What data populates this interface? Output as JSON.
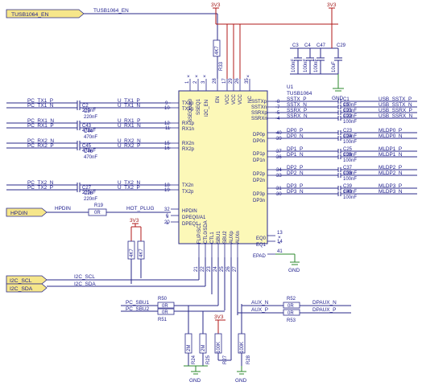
{
  "ic": {
    "designator": "U1",
    "part": "TUSB1064",
    "left_pins": [
      {
        "num": "9",
        "name": "TX1p"
      },
      {
        "num": "10",
        "name": "TX1n"
      },
      {
        "num": "12",
        "name": "RX1p"
      },
      {
        "num": "11",
        "name": "RX1n"
      },
      {
        "num": "15",
        "name": "RX2n"
      },
      {
        "num": "16",
        "name": "RX2p"
      },
      {
        "num": "18",
        "name": "TX2n"
      },
      {
        "num": "19",
        "name": "TX2p"
      },
      {
        "num": "32",
        "name": "HPDIN"
      },
      {
        "num": "6",
        "name": "DPEQ0/A1"
      },
      {
        "num": "20",
        "name": "DPEQ1"
      }
    ],
    "right_pins": [
      {
        "num": "8",
        "name": "SSTXp"
      },
      {
        "num": "7",
        "name": "SSTXn"
      },
      {
        "num": "5",
        "name": "SSRXp"
      },
      {
        "num": "4",
        "name": "SSRXn"
      },
      {
        "num": "40",
        "name": "DP0p"
      },
      {
        "num": "39",
        "name": "DP0n"
      },
      {
        "num": "37",
        "name": "DP1p"
      },
      {
        "num": "36",
        "name": "DP1n"
      },
      {
        "num": "34",
        "name": "DP2p"
      },
      {
        "num": "33",
        "name": "DP2n"
      },
      {
        "num": "31",
        "name": "DP3p"
      },
      {
        "num": "30",
        "name": "DP3n"
      },
      {
        "num": "13",
        "name": "EQ0"
      },
      {
        "num": "14",
        "name": "EQ1"
      },
      {
        "num": "41",
        "name": "EPAD"
      }
    ],
    "top_pins": [
      {
        "num": "1",
        "name": "SSEQ0/A0"
      },
      {
        "num": "2",
        "name": "SSEQ1"
      },
      {
        "num": "3",
        "name": "I2C_EN"
      },
      {
        "num": "28",
        "name": "EN"
      },
      {
        "num": "17",
        "name": "VCC"
      },
      {
        "num": "29",
        "name": "VCC"
      },
      {
        "num": "26",
        "name": "VCC"
      },
      {
        "num": "35",
        "name": "NC"
      }
    ],
    "bottom_pins": [
      {
        "num": "21",
        "name": "FLIP/SCL"
      },
      {
        "num": "22",
        "name": "CTL0/SDA"
      },
      {
        "num": "23",
        "name": "CTL1"
      },
      {
        "num": "24",
        "name": "SBU1"
      },
      {
        "num": "25",
        "name": "SBU2"
      },
      {
        "num": "26",
        "name": "AUXp"
      },
      {
        "num": "27",
        "name": "AUXn"
      }
    ]
  },
  "ports": {
    "tusb_en": "TUSB1064_EN",
    "hpdin": "HPDIN",
    "i2c_scl": "I2C_SCL",
    "i2c_sda": "I2C_SDA"
  },
  "nets": {
    "tusb_en": "TUSB1064_EN",
    "hpdin": "HPDIN",
    "hot_plug": "HOT_PLUG",
    "i2c_scl": "I2C_SCL",
    "i2c_sda": "I2C_SDA",
    "pc_sbu1": "PC_SBU1",
    "pc_sbu2": "PC_SBU2",
    "aux_n": "AUX_N",
    "aux_p": "AUX_P",
    "dpaux_n": "DPAUX_N",
    "dpaux_p": "DPAUX_P"
  },
  "left_channels": [
    {
      "pc": "PC_TX1_P",
      "cap": "C2",
      "val": "220nF",
      "u": "U_TX1_P"
    },
    {
      "pc": "PC_TX1_N",
      "cap": "C3",
      "val": "220nF",
      "u": "U_TX1_N"
    },
    {
      "pc": "PC_RX1_N",
      "cap": "C43",
      "val": "470nF",
      "u": "U_RX1_P"
    },
    {
      "pc": "PC_RX1_P",
      "cap": "C44",
      "val": "470nF",
      "u": "U_RX1_N"
    },
    {
      "pc": "PC_RX2_N",
      "cap": "C45",
      "val": "470nF",
      "u": "U_RX2_N"
    },
    {
      "pc": "PC_RX2_P",
      "cap": "C46",
      "val": "470nF",
      "u": "U_RX2_P"
    },
    {
      "pc": "PC_TX2_N",
      "cap": "C27",
      "val": "220nF",
      "u": "U_TX2_N"
    },
    {
      "pc": "PC_TX2_P",
      "cap": "C28",
      "val": "220nF",
      "u": "U_TX2_P"
    }
  ],
  "right_channels": [
    {
      "net": "SSTX_P",
      "cap": "C1",
      "val": "100nF",
      "out": "USB_SSTX_P"
    },
    {
      "net": "SSTX_N",
      "cap": "C5",
      "val": "100nF",
      "out": "USB_SSTX_N"
    },
    {
      "net": "SSRX_P",
      "cap": "C21",
      "val": "100nF",
      "out": "USB_SSRX_P"
    },
    {
      "net": "SSRX_N",
      "cap": "C22",
      "val": "100nF",
      "out": "USB_SSRX_N"
    },
    {
      "net": "DP0_P",
      "cap": "C23",
      "val": "100nF",
      "out": "MLDP0_P"
    },
    {
      "net": "DP0_N",
      "cap": "C24",
      "val": "100nF",
      "out": "MLDP0_N"
    },
    {
      "net": "DP1_P",
      "cap": "C25",
      "val": "100nF",
      "out": "MLDP1_P"
    },
    {
      "net": "DP1_N",
      "cap": "C26",
      "val": "100nF",
      "out": "MLDP1_N"
    },
    {
      "net": "DP2_P",
      "cap": "C37",
      "val": "100nF",
      "out": "MLDP2_P"
    },
    {
      "net": "DP2_N",
      "cap": "C38",
      "val": "100nF",
      "out": "MLDP2_N"
    },
    {
      "net": "DP3_P",
      "cap": "C39",
      "val": "100nF",
      "out": "MLDP3_P"
    },
    {
      "net": "DP3_N",
      "cap": "C40",
      "val": "100nF",
      "out": "MLDP3_N"
    }
  ],
  "decoupling": [
    {
      "ref": "C3",
      "val": "100nF"
    },
    {
      "ref": "C4",
      "val": "100nF"
    },
    {
      "ref": "C47",
      "val": "100nF"
    },
    {
      "ref": "C29",
      "val": "10uF"
    }
  ],
  "resistors": {
    "r19": {
      "ref": "R19",
      "val": "0R"
    },
    "r33": {
      "ref": "R33",
      "val": "4K7"
    },
    "r50": {
      "ref": "R50",
      "val": "0R"
    },
    "r51": {
      "ref": "R51",
      "val": "0R"
    },
    "r52": {
      "ref": "R52",
      "val": "0R"
    },
    "r53": {
      "ref": "R53",
      "val": "0R"
    },
    "pull_a": {
      "ref": "R",
      "val": "4K7"
    },
    "pull_b": {
      "ref": "R",
      "val": "4K7"
    },
    "r24": {
      "ref": "R24",
      "val": "2M"
    },
    "r25": {
      "ref": "R25",
      "val": "2M"
    },
    "r27": {
      "ref": "R27",
      "val": "100K"
    },
    "r28": {
      "ref": "R28",
      "val": "100K"
    }
  },
  "power": {
    "v3v3": "3V3",
    "gnd": "GND"
  }
}
